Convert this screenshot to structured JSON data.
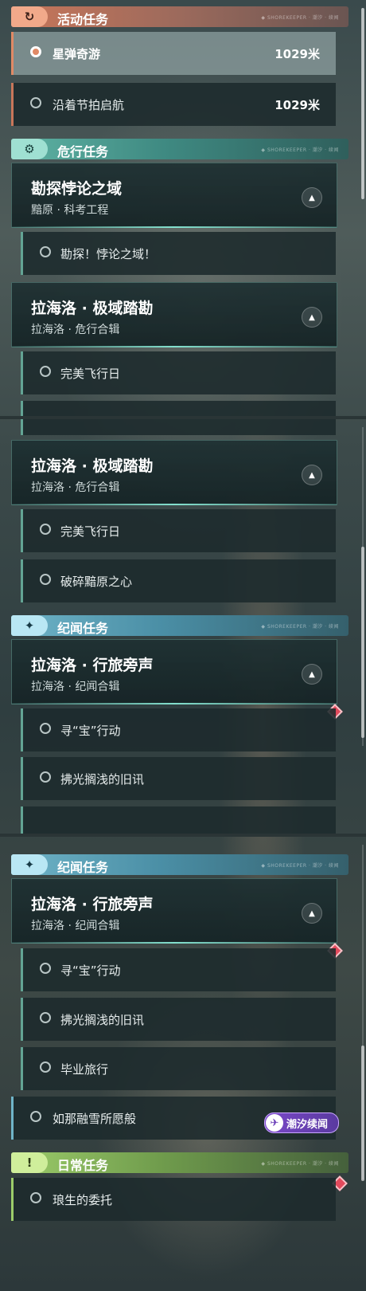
{
  "sections": {
    "activity": {
      "title": "活动任务",
      "icon": "return-arrow-icon",
      "tiny": "◆ SHOREKEEPER · 潮汐 · 续闻"
    },
    "danger": {
      "title": "危行任务",
      "icon": "gear-compass-icon",
      "tiny": "◆ SHOREKEEPER · 潮汐 · 续闻"
    },
    "lore": {
      "title": "纪闻任务",
      "icon": "sparkle-icon",
      "tiny": "◆ SHOREKEEPER · 潮汐 · 续闻"
    },
    "daily": {
      "title": "日常任务",
      "icon": "exclamation-icon",
      "tiny": "◆ SHOREKEEPER · 潮汐 · 续闻"
    }
  },
  "activity_quests": [
    {
      "label": "星弹奇游",
      "distance": "1029米"
    },
    {
      "label": "沿着节拍启航",
      "distance": "1029米"
    }
  ],
  "cards": {
    "paradox": {
      "title": "勘探悖论之域",
      "subtitle": "黯原 · 科考工程"
    },
    "polar": {
      "title": "拉海洛 · 极域踏勘",
      "subtitle": "拉海洛 · 危行合辑"
    },
    "travel": {
      "title": "拉海洛 · 行旅旁声",
      "subtitle": "拉海洛 · 纪闻合辑"
    }
  },
  "subquests": {
    "explore": "勘探！悖论之域！",
    "perfect_flight": "完美飞行日",
    "shatter": "破碎黯原之心",
    "treasure": "寻“宝”行动",
    "whisper": "拂光搁浅的旧讯",
    "graduation": "毕业旅行",
    "snow": "如那融雪所愿般",
    "wolf": "琅生的委托"
  },
  "badge": {
    "label": "潮汐续闻",
    "icon": "bird-emblem-icon"
  },
  "colors": {
    "activity": "#c8765a",
    "danger": "#5fb3a4",
    "lore": "#6fb4c8",
    "daily": "#9ccc6a",
    "marker": "#e24a5c"
  }
}
